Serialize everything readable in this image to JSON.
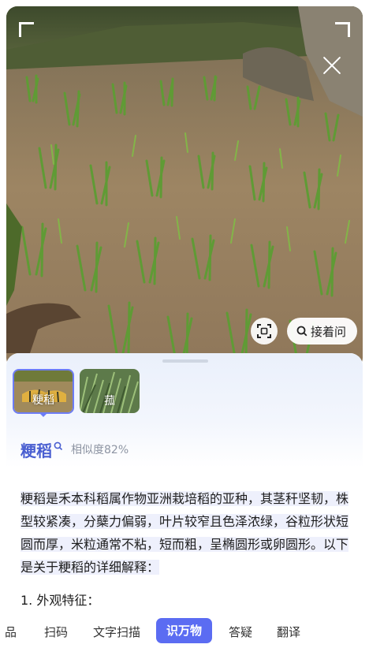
{
  "camera": {
    "scan_icon": "scan-frame-icon",
    "ask_label": "接着问",
    "close_icon": "close-icon"
  },
  "result": {
    "candidates": [
      {
        "label": "粳稻",
        "selected": true
      },
      {
        "label": "菰",
        "selected": false
      }
    ],
    "title": "粳稻",
    "similarity": "相似度82%",
    "description": "粳稻是禾本科稻属作物亚洲栽培稻的亚种，其茎秆坚韧，株型较紧凑，分蘖力偏弱，叶片较窄且色泽浓绿，谷粒形状短圆而厚，米粒通常不粘，短而粗，呈椭圆形或卵圆形。以下是关于粳稻的详细解释：",
    "section_heading": "1. 外观特征："
  },
  "tabs": {
    "items": [
      "品",
      "扫码",
      "文字扫描",
      "识万物",
      "答疑",
      "翻译"
    ],
    "active": "识万物"
  },
  "colors": {
    "accent": "#5b6cf2",
    "title_blue": "#4a5fd1"
  }
}
